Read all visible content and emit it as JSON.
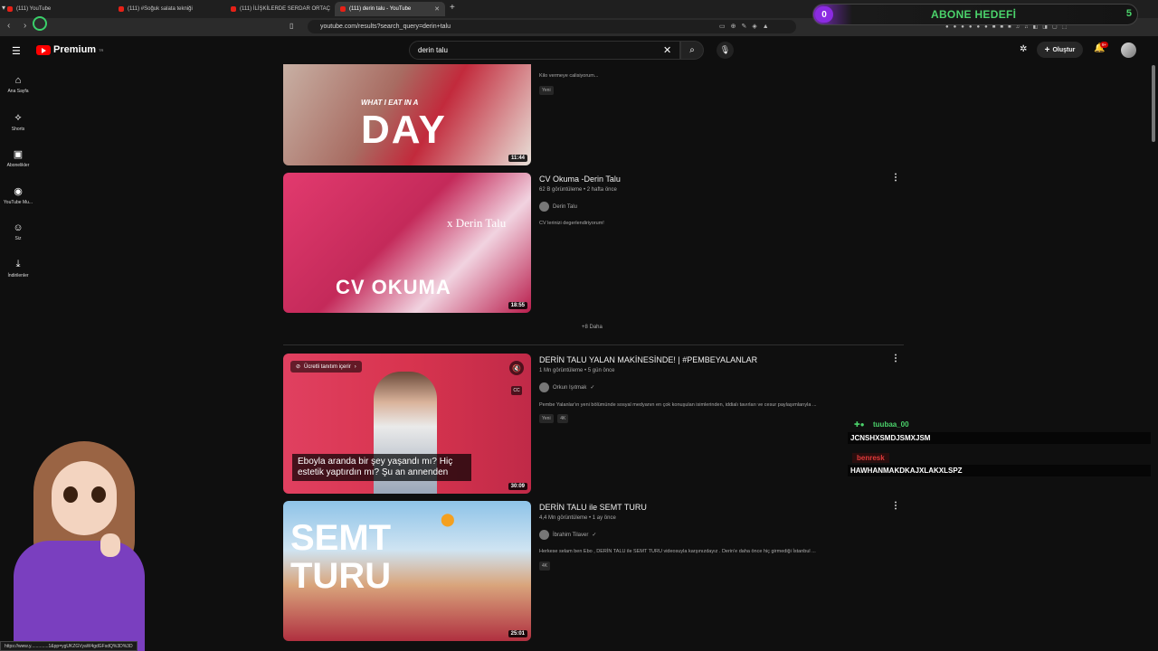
{
  "browser": {
    "tabs": [
      {
        "label": "(111) YouTube"
      },
      {
        "label": "(111) #Soğuk salata tekniği"
      },
      {
        "label": "(111) İLİŞKİLERDE SERDAR ORTAÇ"
      },
      {
        "label": "(111) derin talu - YouTube"
      }
    ],
    "url": "youtube.com/results?search_query=derin+talu",
    "status_url": "https://www.y..............1&pp=ygUKZGVyaW4gdGFsdQ%3D%3D"
  },
  "overlay": {
    "count": "0",
    "label": "ABONE HEDEFİ",
    "goal": "5"
  },
  "header": {
    "logo_word": "Premium",
    "logo_region": "TR",
    "search_query": "derin talu",
    "create_label": "Oluştur",
    "notif_count": "9+"
  },
  "sidebar": {
    "items": [
      {
        "label": "Ana Sayfa",
        "icon": "home-icon"
      },
      {
        "label": "Shorts",
        "icon": "shorts-icon"
      },
      {
        "label": "Abonelikler",
        "icon": "subscriptions-icon"
      },
      {
        "label": "YouTube Mu...",
        "icon": "music-icon"
      },
      {
        "label": "Siz",
        "icon": "you-icon"
      },
      {
        "label": "İndirilenler",
        "icon": "download-icon"
      }
    ]
  },
  "results": {
    "v0": {
      "desc": "Kilo vermeye calisiyorum...",
      "badge": "Yeni",
      "duration": "11:44",
      "thumb_text_top": "WHAT I EAT IN A",
      "thumb_text_big": "DAY"
    },
    "v1": {
      "title": "CV Okuma -Derin Talu",
      "meta": "62 B görüntüleme • 2 hafta önce",
      "channel": "Derin Talu",
      "desc": "CV lerinizi degerlendiriyorum!",
      "duration": "18:55",
      "thumb_text_name": "x Derin Talu",
      "thumb_text_big": "CV OKUMA"
    },
    "more_label": "+8 Daha",
    "v2": {
      "title": "DERİN TALU YALAN MAKİNESİNDE! | #PEMBEYALANLAR",
      "meta": "1 Mn görüntüleme • 5 gün önce",
      "channel": "Orkun Işıtmak",
      "desc": "Pembe Yalanlar'ın yeni bölümünde sosyal medyanın en çok konuşulan isimlerinden, iddialı tavırları ve cesur paylaşımlarıyla ...",
      "badges": [
        "Yeni",
        "4K"
      ],
      "duration": "30:09",
      "promo": "Ücretli tanıtım içerir",
      "caption": "Eboyla aranda bir şey yaşandı mı? Hiç estetik yaptırdın mı? Şu an annenden"
    },
    "v3": {
      "title": "DERİN TALU ile SEMT TURU",
      "meta": "4,4 Mn görüntüleme • 1 ay önce",
      "channel": "İbrahim Tilaver",
      "desc": "Herkese selam ben Ebo , DERİN TALU ile SEMT TURU videosuyla karşınızdayız . Derin'e daha önce hiç girmediği İstanbul ...",
      "badge": "4K",
      "duration": "25:01",
      "thumb_text_big": "SEMT TURU"
    }
  },
  "chat": [
    {
      "name": "tuubaa_00",
      "message": "JCNSHXSMDJSMXJSM",
      "color": "#4bd36b"
    },
    {
      "name": "benresk",
      "message": "HAWHANMAKDKAJXLAKXLSPZ",
      "color": "#e23a3a"
    }
  ]
}
